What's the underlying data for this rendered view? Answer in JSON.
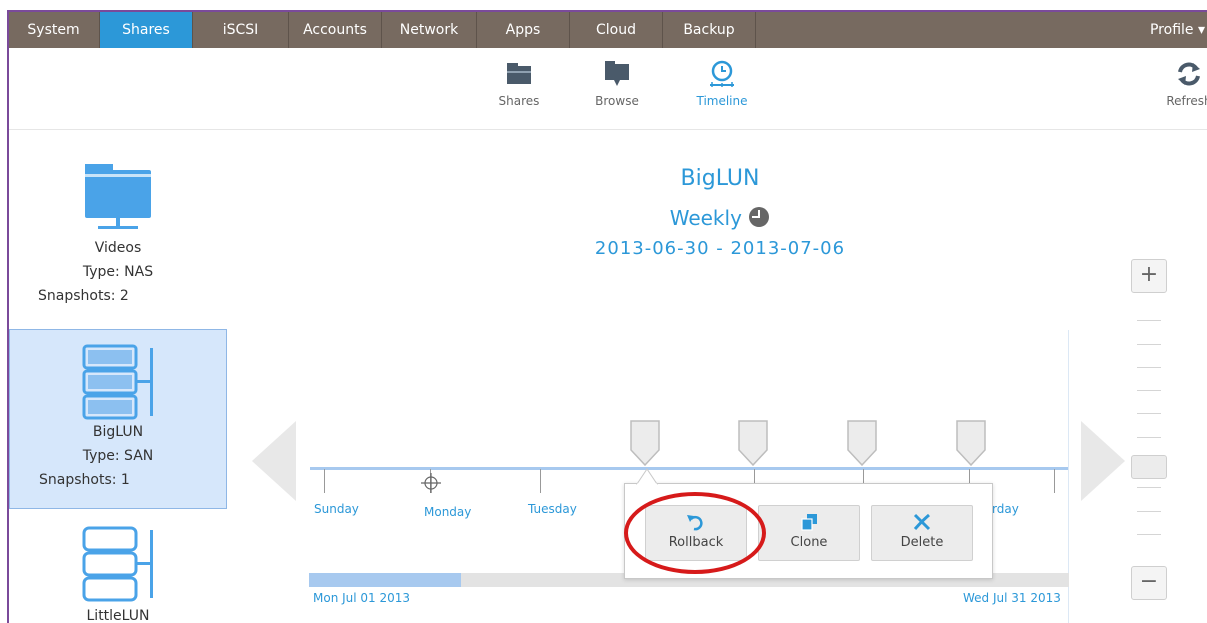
{
  "topnav": {
    "tabs": [
      {
        "label": "System"
      },
      {
        "label": "Shares"
      },
      {
        "label": "iSCSI"
      },
      {
        "label": "Accounts"
      },
      {
        "label": "Network"
      },
      {
        "label": "Apps"
      },
      {
        "label": "Cloud"
      },
      {
        "label": "Backup"
      }
    ],
    "active_tab": "Shares",
    "profile_label": "Profile ▾"
  },
  "subbar": {
    "shares_label": "Shares",
    "browse_label": "Browse",
    "timeline_label": "Timeline",
    "refresh_label": "Refresh"
  },
  "shares": [
    {
      "name": "Videos",
      "type": "Type: NAS",
      "snapshots": "Snapshots: 2"
    },
    {
      "name": "BigLUN",
      "type": "Type: SAN",
      "snapshots": "Snapshots: 1"
    },
    {
      "name": "LittleLUN"
    }
  ],
  "header": {
    "title": "BigLUN",
    "period": "Weekly",
    "range": "2013-06-30  -  2013-07-06"
  },
  "timeline": {
    "days": [
      "Sunday",
      "Monday",
      "Tuesday",
      "rday"
    ],
    "start_date": "Mon Jul 01 2013",
    "end_date": "Wed Jul 31 2013",
    "range_fill_fraction": 0.2
  },
  "popup": {
    "rollback_label": "Rollback",
    "clone_label": "Clone",
    "delete_label": "Delete"
  },
  "zoom": {
    "plus": "+",
    "minus": "−"
  },
  "colors": {
    "nav_bg": "#776a60",
    "accent": "#2c98d8",
    "selected_bg": "#d6e7fb",
    "highlight_ring": "#d61a1a"
  }
}
